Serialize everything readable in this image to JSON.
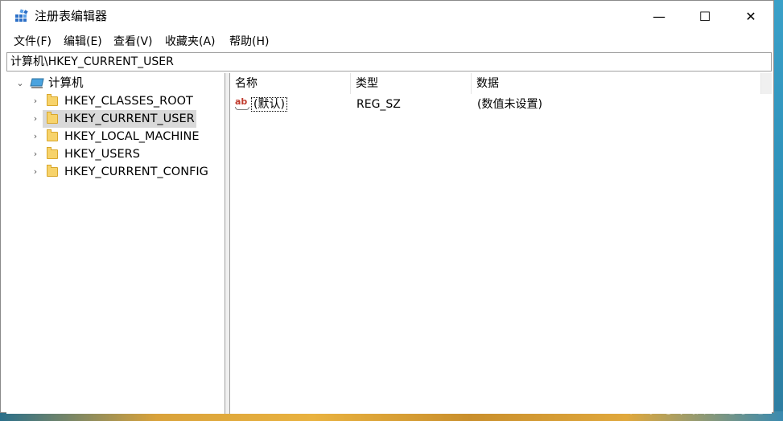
{
  "window": {
    "title": "注册表编辑器",
    "controls": {
      "minimize": "—",
      "maximize": "☐",
      "close": "✕"
    }
  },
  "menu": [
    "文件(F)",
    "编辑(E)",
    "查看(V)",
    "收藏夹(A)",
    "帮助(H)"
  ],
  "address": "计算机\\HKEY_CURRENT_USER",
  "tree": {
    "root": "计算机",
    "items": [
      {
        "label": "HKEY_CLASSES_ROOT"
      },
      {
        "label": "HKEY_CURRENT_USER"
      },
      {
        "label": "HKEY_LOCAL_MACHINE"
      },
      {
        "label": "HKEY_USERS"
      },
      {
        "label": "HKEY_CURRENT_CONFIG"
      }
    ]
  },
  "list": {
    "headers": [
      "名称",
      "类型",
      "数据"
    ],
    "rows": [
      {
        "name": "(默认)",
        "type": "REG_SZ",
        "data": "(数值未设置)"
      }
    ]
  },
  "watermark": "头条号 / 技术宅小葱"
}
